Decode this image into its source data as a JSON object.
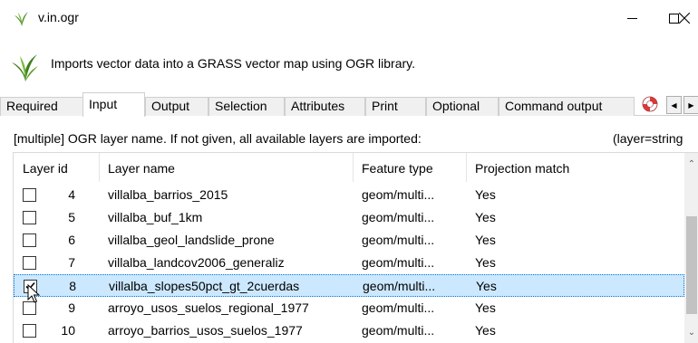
{
  "window": {
    "title": "v.in.ogr",
    "close_glyph": "✕"
  },
  "header": {
    "description": "Imports vector data into a GRASS vector map using OGR library."
  },
  "tabs": [
    {
      "label": "Required"
    },
    {
      "label": "Input"
    },
    {
      "label": "Output"
    },
    {
      "label": "Selection"
    },
    {
      "label": "Attributes"
    },
    {
      "label": "Print"
    },
    {
      "label": "Optional"
    },
    {
      "label": "Command output"
    }
  ],
  "active_tab": "Input",
  "field": {
    "label": "[multiple] OGR layer name. If not given, all available layers are imported:",
    "key": "(layer=string"
  },
  "list": {
    "columns": [
      "Layer id",
      "Layer name",
      "Feature type",
      "Projection match"
    ],
    "rows": [
      {
        "checked": false,
        "id": "4",
        "name": "villalba_barrios_2015",
        "type": "geom/multi...",
        "proj": "Yes"
      },
      {
        "checked": false,
        "id": "5",
        "name": "villalba_buf_1km",
        "type": "geom/multi...",
        "proj": "Yes"
      },
      {
        "checked": false,
        "id": "6",
        "name": "villalba_geol_landslide_prone",
        "type": "geom/multi...",
        "proj": "Yes"
      },
      {
        "checked": false,
        "id": "7",
        "name": "villalba_landcov2006_generaliz",
        "type": "geom/multi...",
        "proj": "Yes"
      },
      {
        "checked": true,
        "id": "8",
        "name": "villalba_slopes50pct_gt_2cuerdas",
        "type": "geom/multi...",
        "proj": "Yes"
      },
      {
        "checked": false,
        "id": "9",
        "name": "arroyo_usos_suelos_regional_1977",
        "type": "geom/multi...",
        "proj": "Yes"
      },
      {
        "checked": false,
        "id": "10",
        "name": "arroyo_barrios_usos_suelos_1977",
        "type": "geom/multi...",
        "proj": "Yes"
      }
    ],
    "selected_row": "8"
  },
  "colors": {
    "selection_bg": "#cce8ff",
    "selection_border": "#0078d7"
  }
}
